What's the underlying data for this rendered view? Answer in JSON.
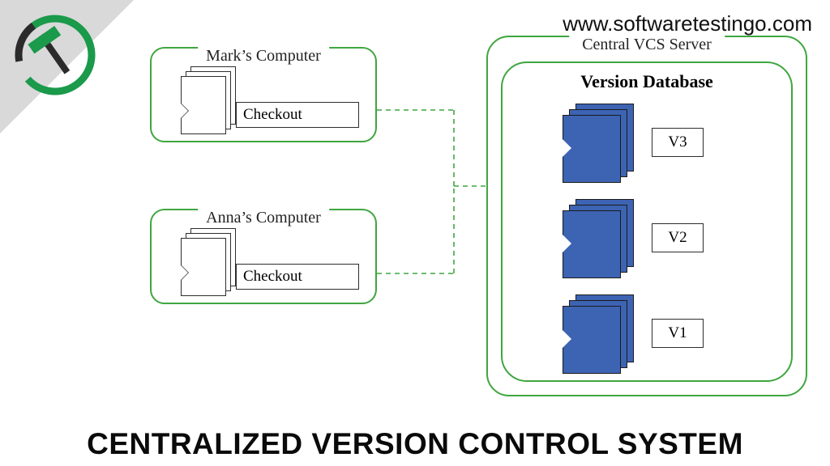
{
  "url": "www.softwaretestingo.com",
  "title": "CENTRALIZED VERSION CONTROL SYSTEM",
  "colors": {
    "accent": "#3fa63f",
    "folder": "#3d63b3",
    "corner": "#d9d9d9"
  },
  "logo": {
    "name": "hammer-check-logo"
  },
  "clients": [
    {
      "name": "Mark’s Computer",
      "checkout": "Checkout"
    },
    {
      "name": "Anna’s Computer",
      "checkout": "Checkout"
    }
  ],
  "server": {
    "label": "Central VCS Server",
    "database_label": "Version Database",
    "versions": [
      "V3",
      "V2",
      "V1"
    ]
  }
}
